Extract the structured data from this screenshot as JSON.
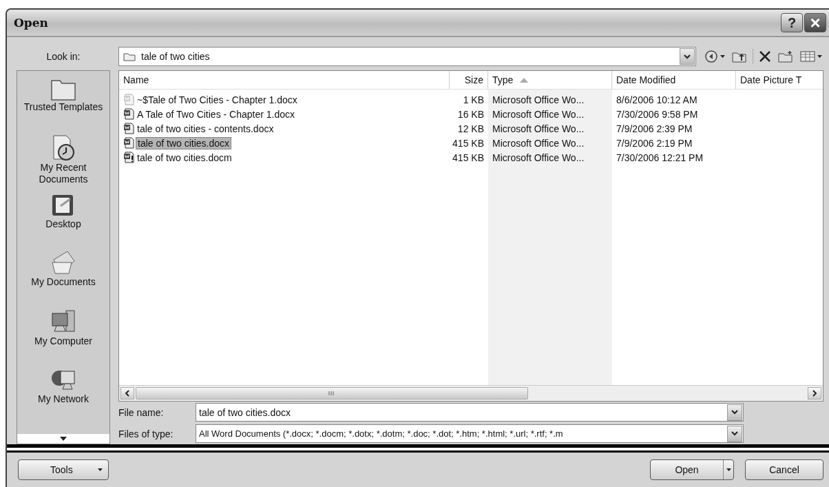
{
  "window": {
    "title": "Open"
  },
  "title_buttons": [
    {
      "kind": "help",
      "label": "?"
    },
    {
      "kind": "close",
      "label": "×"
    }
  ],
  "look_in": {
    "label": "Look in:",
    "value": "tale of two cities"
  },
  "toolbar": [
    {
      "kind": "back",
      "dropdown": true
    },
    {
      "kind": "up",
      "dropdown": false
    },
    {
      "kind": "delete",
      "dropdown": false
    },
    {
      "kind": "newfolder",
      "dropdown": false
    },
    {
      "kind": "views",
      "dropdown": true
    }
  ],
  "sidebar": {
    "items": [
      {
        "kind": "folder",
        "label": "Trusted Templates"
      },
      {
        "kind": "recent",
        "label": "My Recent Documents"
      },
      {
        "kind": "desktop",
        "label": "Desktop"
      },
      {
        "kind": "documents",
        "label": "My Documents"
      },
      {
        "kind": "computer",
        "label": "My Computer"
      },
      {
        "kind": "network",
        "label": "My Network"
      }
    ]
  },
  "table": {
    "columns": [
      {
        "label": "Name",
        "sorted": false
      },
      {
        "label": "Size",
        "sorted": false
      },
      {
        "label": "Type",
        "sorted": true
      },
      {
        "label": "Date Modified",
        "sorted": false
      },
      {
        "label": "Date Picture T",
        "sorted": false
      }
    ],
    "rows": [
      {
        "kind": "temp",
        "name": "~$Tale of Two Cities - Chapter 1.docx",
        "size": "1 KB",
        "type": "Microsoft Office Wo...",
        "date": "8/6/2006 10:12 AM",
        "selected": false
      },
      {
        "kind": "docx",
        "name": "A Tale of Two Cities - Chapter 1.docx",
        "size": "16 KB",
        "type": "Microsoft Office Wo...",
        "date": "7/30/2006 9:58 PM",
        "selected": false
      },
      {
        "kind": "docx",
        "name": "tale of two cities - contents.docx",
        "size": "12 KB",
        "type": "Microsoft Office Wo...",
        "date": "7/9/2006 2:39 PM",
        "selected": false
      },
      {
        "kind": "docx",
        "name": "tale of two cities.docx",
        "size": "415 KB",
        "type": "Microsoft Office Wo...",
        "date": "7/9/2006 2:19 PM",
        "selected": true
      },
      {
        "kind": "docm",
        "name": "tale of two cities.docm",
        "size": "415 KB",
        "type": "Microsoft Office Wo...",
        "date": "7/30/2006 12:21 PM",
        "selected": false
      }
    ]
  },
  "file_name": {
    "label": "File name:",
    "value": "tale of two cities.docx"
  },
  "file_type": {
    "label": "Files of type:",
    "value": "All Word Documents (*.docx; *.docm; *.dotx; *.dotm; *.doc; *.dot; *.htm; *.html; *.url; *.rtf; *.m"
  },
  "buttons": [
    {
      "kind": "tools",
      "label": "Tools",
      "dropdown": true
    },
    {
      "kind": "open",
      "label": "Open",
      "dropdown": true
    },
    {
      "kind": "cancel",
      "label": "Cancel",
      "dropdown": false
    }
  ]
}
